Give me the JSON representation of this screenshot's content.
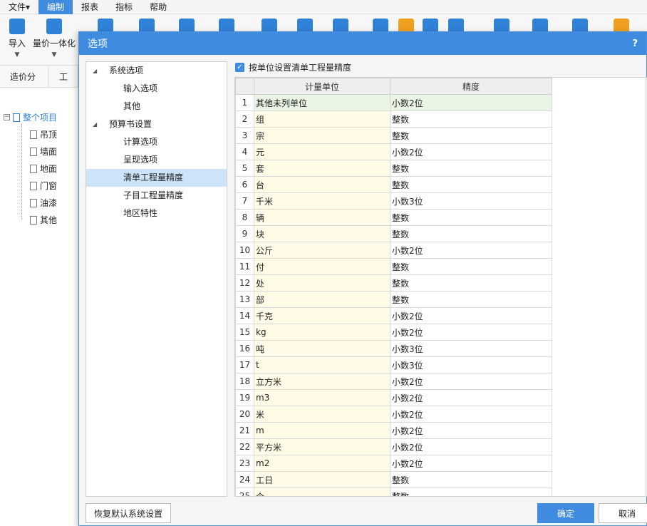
{
  "menu": [
    "文件▾",
    "编制",
    "报表",
    "指标",
    "帮助"
  ],
  "toolbar": {
    "import_label": "导入",
    "unify_label": "量价一体化"
  },
  "left_tabs": [
    "造价分析",
    "工"
  ],
  "project_tree": {
    "root": "整个项目",
    "children": [
      "吊顶",
      "墙面",
      "地面",
      "门窗",
      "油漆",
      "其他"
    ]
  },
  "dialog": {
    "title": "选项",
    "help": "?",
    "nav": [
      {
        "label": "系统选项",
        "level": 0
      },
      {
        "label": "输入选项",
        "level": 1
      },
      {
        "label": "其他",
        "level": 1
      },
      {
        "label": "预算书设置",
        "level": 0
      },
      {
        "label": "计算选项",
        "level": 1
      },
      {
        "label": "呈现选项",
        "level": 1
      },
      {
        "label": "清单工程量精度",
        "level": 1,
        "selected": true
      },
      {
        "label": "子目工程量精度",
        "level": 1
      },
      {
        "label": "地区特性",
        "level": 1
      }
    ],
    "checkbox_label": "按单位设置清单工程量精度",
    "columns": [
      "计量单位",
      "精度"
    ],
    "rows": [
      {
        "n": "1",
        "unit": "其他未列单位",
        "precision": "小数2位"
      },
      {
        "n": "2",
        "unit": "组",
        "precision": "整数"
      },
      {
        "n": "3",
        "unit": "宗",
        "precision": "整数"
      },
      {
        "n": "4",
        "unit": "元",
        "precision": "小数2位"
      },
      {
        "n": "5",
        "unit": "套",
        "precision": "整数"
      },
      {
        "n": "6",
        "unit": "台",
        "precision": "整数"
      },
      {
        "n": "7",
        "unit": "千米",
        "precision": "小数3位"
      },
      {
        "n": "8",
        "unit": "辆",
        "precision": "整数"
      },
      {
        "n": "9",
        "unit": "块",
        "precision": "整数"
      },
      {
        "n": "10",
        "unit": "公斤",
        "precision": "小数2位"
      },
      {
        "n": "11",
        "unit": "付",
        "precision": "整数"
      },
      {
        "n": "12",
        "unit": "处",
        "precision": "整数"
      },
      {
        "n": "13",
        "unit": "部",
        "precision": "整数"
      },
      {
        "n": "14",
        "unit": "千克",
        "precision": "小数2位"
      },
      {
        "n": "15",
        "unit": "kg",
        "precision": "小数2位"
      },
      {
        "n": "16",
        "unit": "吨",
        "precision": "小数3位"
      },
      {
        "n": "17",
        "unit": "t",
        "precision": "小数3位"
      },
      {
        "n": "18",
        "unit": "立方米",
        "precision": "小数2位"
      },
      {
        "n": "19",
        "unit": "m3",
        "precision": "小数2位"
      },
      {
        "n": "20",
        "unit": "米",
        "precision": "小数2位"
      },
      {
        "n": "21",
        "unit": "m",
        "precision": "小数2位"
      },
      {
        "n": "22",
        "unit": "平方米",
        "precision": "小数2位"
      },
      {
        "n": "23",
        "unit": "m2",
        "precision": "小数2位"
      },
      {
        "n": "24",
        "unit": "工日",
        "precision": "整数"
      },
      {
        "n": "25",
        "unit": "个",
        "precision": "整数"
      }
    ],
    "restore_label": "恢复默认系统设置",
    "ok_label": "确定",
    "cancel_label": "取消"
  },
  "colors": {
    "accent": "#3f8be0",
    "unit_cell": "#fffbe6",
    "first_row": "#eaf5e4",
    "selected_nav": "#cde3f7"
  }
}
